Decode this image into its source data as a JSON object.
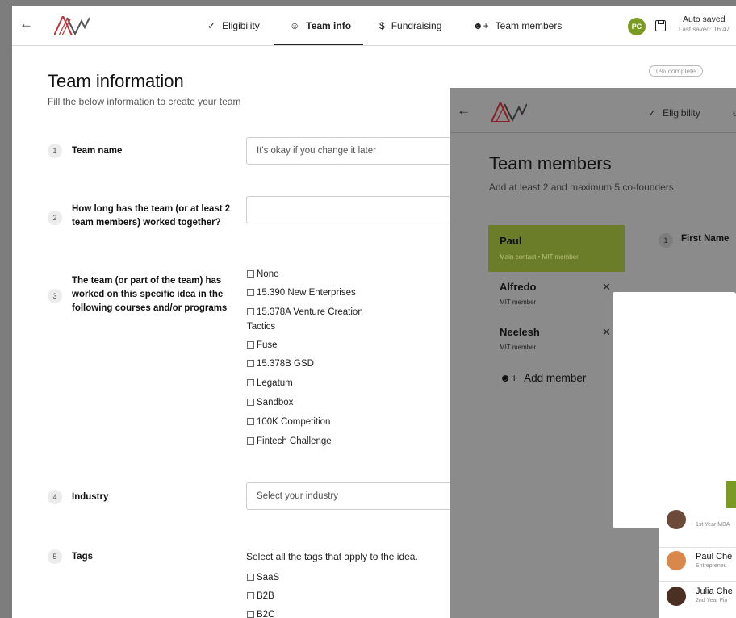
{
  "colors": {
    "accent": "#7a9a23",
    "logo": "#c4333a"
  },
  "main": {
    "nav": {
      "back_icon": "arrow-left-icon",
      "tabs": [
        {
          "label": "Eligibility",
          "icon": "check-circle-icon"
        },
        {
          "label": "Team info",
          "icon": "users-icon",
          "active": true
        },
        {
          "label": "Fundraising",
          "icon": "dollar-icon"
        },
        {
          "label": "Team members",
          "icon": "user-plus-icon"
        }
      ],
      "avatar": "PC",
      "save_status": "Auto saved",
      "last_saved": "Last saved: 16:47",
      "progress": "0% complete"
    },
    "title": "Team information",
    "subtitle": "Fill the below information to create your team",
    "questions": [
      {
        "num": "1",
        "label": "Team name",
        "placeholder": "It's okay if you change it later"
      },
      {
        "num": "2",
        "label": "How long has the team (or at least 2 team members) worked together?",
        "value": ""
      },
      {
        "num": "3",
        "label": "The team (or part of the team) has worked on this specific idea in the following courses and/or programs",
        "options": [
          "None",
          "15.390 New Enterprises",
          "15.378A Venture Creation",
          "Tactics",
          "Fuse",
          "15.378B GSD",
          "Legatum",
          "Sandbox",
          "100K Competition",
          "Fintech Challenge"
        ]
      },
      {
        "num": "4",
        "label": "Industry",
        "placeholder": "Select your industry"
      },
      {
        "num": "5",
        "label": "Tags",
        "hint": "Select all the tags that apply to the idea.",
        "options": [
          "SaaS",
          "B2B",
          "B2C"
        ]
      }
    ]
  },
  "overlay": {
    "nav": {
      "tab": "Eligibility"
    },
    "title": "Team members",
    "subtitle": "Add at least 2 and maximum 5 co-founders",
    "members": [
      {
        "name": "Paul",
        "meta": "Main contact • MIT member"
      },
      {
        "name": "Alfredo",
        "meta": "MIT member"
      },
      {
        "name": "Neelesh",
        "meta": "MIT member"
      }
    ],
    "add_member": "Add member",
    "field_num": "1",
    "field_label": "First Name",
    "people": [
      {
        "name": "",
        "role": "1st Year MBA"
      },
      {
        "name": "Paul Che",
        "role": "Entrepreneu"
      },
      {
        "name": "Julia Che",
        "role": "2nd Year Fin"
      }
    ]
  }
}
